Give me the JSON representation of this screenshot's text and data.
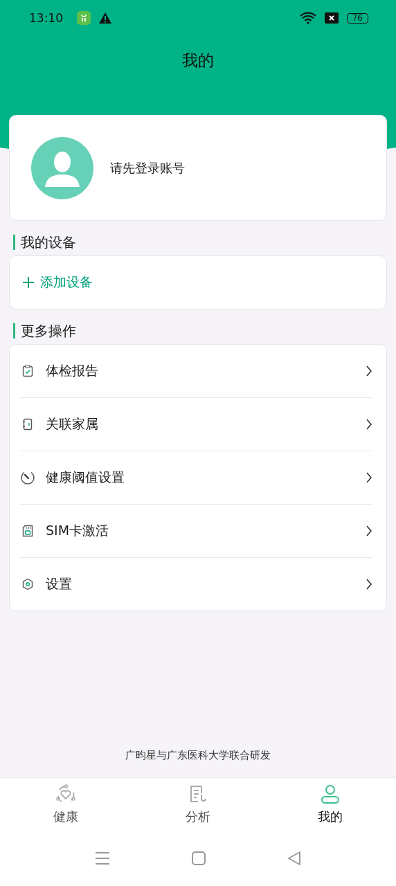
{
  "status_bar": {
    "time": "13:10",
    "battery": "76"
  },
  "header": {
    "title": "我的"
  },
  "profile": {
    "prompt": "请先登录账号"
  },
  "devices": {
    "title": "我的设备",
    "add_label": "添加设备"
  },
  "more": {
    "title": "更多操作",
    "items": [
      {
        "kind": "report",
        "label": "体检报告"
      },
      {
        "kind": "family",
        "label": "关联家属"
      },
      {
        "kind": "threshold",
        "label": "健康阈值设置"
      },
      {
        "kind": "sim",
        "label": "SIM卡激活"
      },
      {
        "kind": "settings",
        "label": "设置"
      }
    ]
  },
  "footer": "广昀星与广东医科大学联合研发",
  "tabs": [
    {
      "kind": "health",
      "label": "健康",
      "selected": false
    },
    {
      "kind": "analysis",
      "label": "分析",
      "selected": false
    },
    {
      "kind": "profile",
      "label": "我的",
      "selected": true
    }
  ]
}
